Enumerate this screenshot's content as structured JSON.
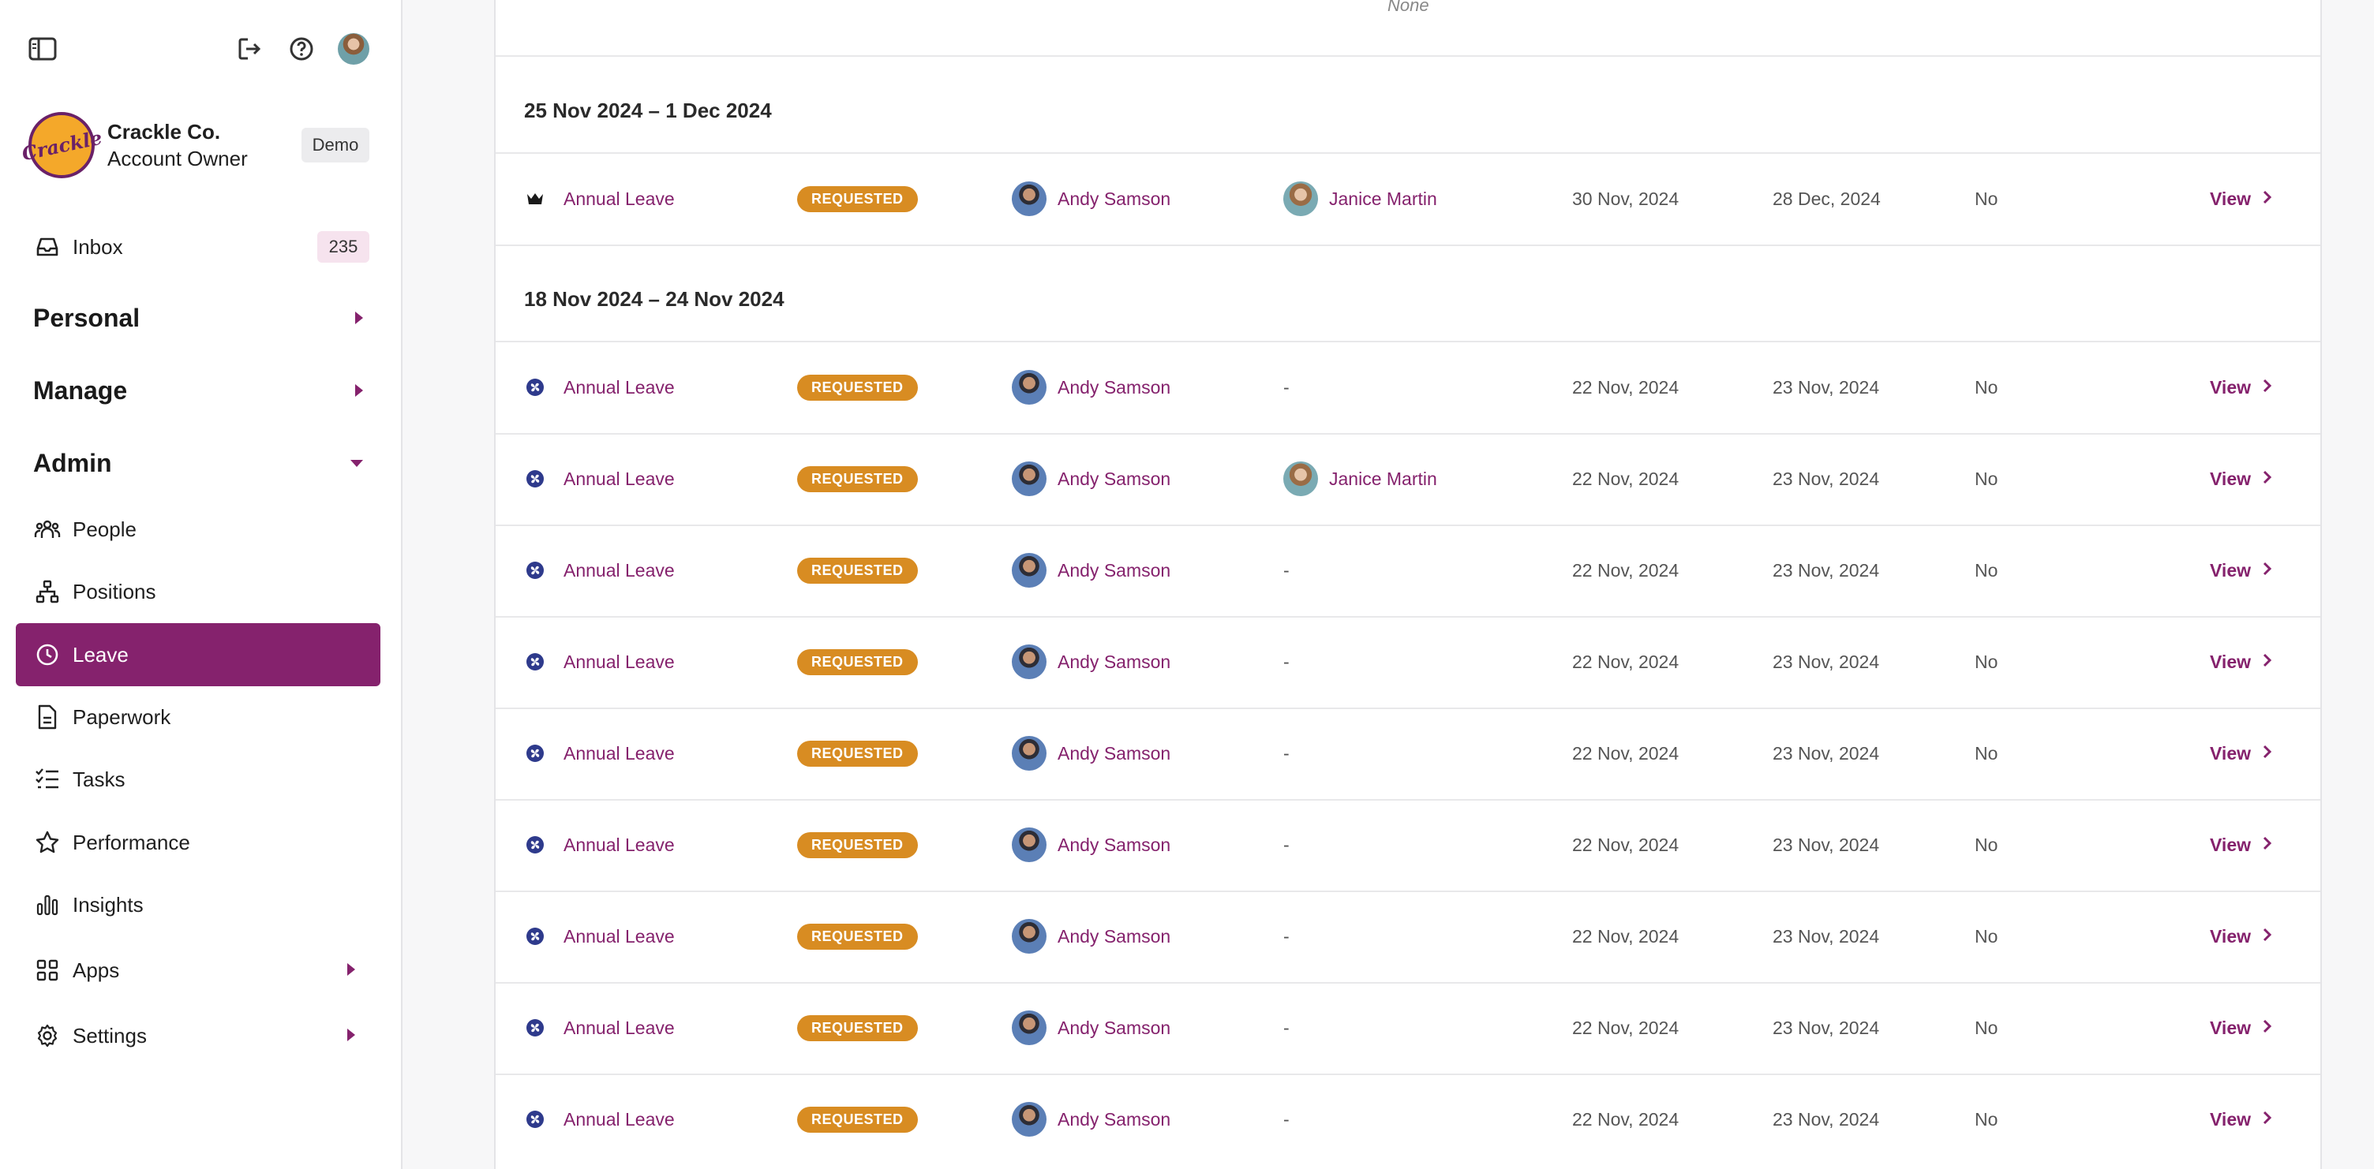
{
  "org": {
    "name": "Crackle Co.",
    "role": "Account Owner",
    "badge": "Demo",
    "logo_text": "Crackle"
  },
  "nav": {
    "inbox": {
      "label": "Inbox",
      "count": "235"
    },
    "personal": "Personal",
    "manage": "Manage",
    "admin": "Admin",
    "people": "People",
    "positions": "Positions",
    "leave": "Leave",
    "paperwork": "Paperwork",
    "tasks": "Tasks",
    "performance": "Performance",
    "insights": "Insights",
    "apps": "Apps",
    "settings": "Settings"
  },
  "main": {
    "prev_none": "None",
    "groups": [
      {
        "week": "25 Nov 2024 – 1 Dec 2024",
        "rows": [
          {
            "icon": "crown-icon",
            "type": "Annual Leave",
            "status": "REQUESTED",
            "employee": "Andy Samson",
            "approver": "Janice Martin",
            "start": "30 Nov, 2024",
            "end": "28 Dec, 2024",
            "half_day": "No",
            "action": "View"
          }
        ]
      },
      {
        "week": "18 Nov 2024 – 24 Nov 2024",
        "rows": [
          {
            "icon": "fan-icon",
            "type": "Annual Leave",
            "status": "REQUESTED",
            "employee": "Andy Samson",
            "approver": "-",
            "start": "22 Nov, 2024",
            "end": "23 Nov, 2024",
            "half_day": "No",
            "action": "View"
          },
          {
            "icon": "fan-icon",
            "type": "Annual Leave",
            "status": "REQUESTED",
            "employee": "Andy Samson",
            "approver": "Janice Martin",
            "start": "22 Nov, 2024",
            "end": "23 Nov, 2024",
            "half_day": "No",
            "action": "View"
          },
          {
            "icon": "fan-icon",
            "type": "Annual Leave",
            "status": "REQUESTED",
            "employee": "Andy Samson",
            "approver": "-",
            "start": "22 Nov, 2024",
            "end": "23 Nov, 2024",
            "half_day": "No",
            "action": "View"
          },
          {
            "icon": "fan-icon",
            "type": "Annual Leave",
            "status": "REQUESTED",
            "employee": "Andy Samson",
            "approver": "-",
            "start": "22 Nov, 2024",
            "end": "23 Nov, 2024",
            "half_day": "No",
            "action": "View"
          },
          {
            "icon": "fan-icon",
            "type": "Annual Leave",
            "status": "REQUESTED",
            "employee": "Andy Samson",
            "approver": "-",
            "start": "22 Nov, 2024",
            "end": "23 Nov, 2024",
            "half_day": "No",
            "action": "View"
          },
          {
            "icon": "fan-icon",
            "type": "Annual Leave",
            "status": "REQUESTED",
            "employee": "Andy Samson",
            "approver": "-",
            "start": "22 Nov, 2024",
            "end": "23 Nov, 2024",
            "half_day": "No",
            "action": "View"
          },
          {
            "icon": "fan-icon",
            "type": "Annual Leave",
            "status": "REQUESTED",
            "employee": "Andy Samson",
            "approver": "-",
            "start": "22 Nov, 2024",
            "end": "23 Nov, 2024",
            "half_day": "No",
            "action": "View"
          },
          {
            "icon": "fan-icon",
            "type": "Annual Leave",
            "status": "REQUESTED",
            "employee": "Andy Samson",
            "approver": "-",
            "start": "22 Nov, 2024",
            "end": "23 Nov, 2024",
            "half_day": "No",
            "action": "View"
          },
          {
            "icon": "fan-icon",
            "type": "Annual Leave",
            "status": "REQUESTED",
            "employee": "Andy Samson",
            "approver": "-",
            "start": "22 Nov, 2024",
            "end": "23 Nov, 2024",
            "half_day": "No",
            "action": "View"
          }
        ]
      }
    ]
  },
  "colors": {
    "accent": "#85226d",
    "status_requested": "#d88c22"
  }
}
